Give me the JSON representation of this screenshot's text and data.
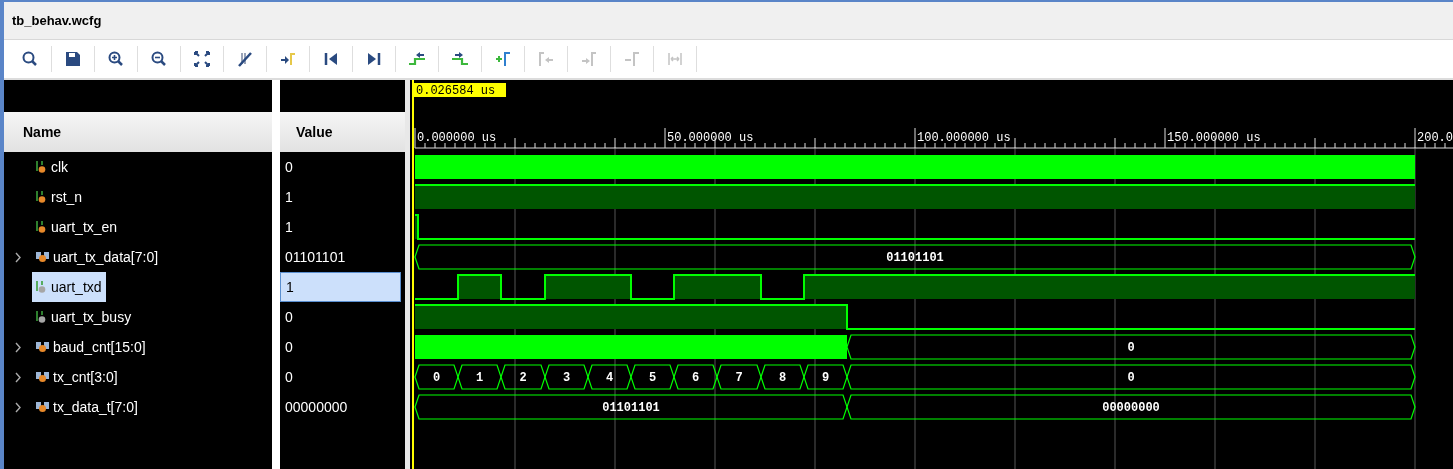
{
  "window": {
    "title": "tb_behav.wcfg"
  },
  "toolbar": [
    {
      "kind": "search",
      "disabled": false
    },
    {
      "kind": "save",
      "disabled": false
    },
    {
      "kind": "zoom-in",
      "disabled": false
    },
    {
      "kind": "zoom-out",
      "disabled": false
    },
    {
      "kind": "fit",
      "disabled": false
    },
    {
      "kind": "cursor-off",
      "disabled": false
    },
    {
      "kind": "to-cursor",
      "disabled": false
    },
    {
      "kind": "first",
      "disabled": false
    },
    {
      "kind": "last",
      "disabled": false
    },
    {
      "kind": "prev-edge",
      "disabled": false
    },
    {
      "kind": "next-edge",
      "disabled": false
    },
    {
      "kind": "add-marker",
      "disabled": false
    },
    {
      "kind": "prev-marker",
      "disabled": true
    },
    {
      "kind": "next-marker",
      "disabled": true
    },
    {
      "kind": "remove-marker",
      "disabled": true
    },
    {
      "kind": "span",
      "disabled": true
    }
  ],
  "cursor": {
    "label": "0.026584 us"
  },
  "timeline": {
    "labels": [
      "0.000000 us",
      "50.000000 us",
      "100.000000 us",
      "150.000000 us",
      "200.0"
    ]
  },
  "columns": [
    "Name",
    "Value"
  ],
  "signals": [
    {
      "name": "clk",
      "value": "0",
      "kind": "bit",
      "color": "#e8892a",
      "selected": false
    },
    {
      "name": "rst_n",
      "value": "1",
      "kind": "bit",
      "color": "#e8892a",
      "selected": false
    },
    {
      "name": "uart_tx_en",
      "value": "1",
      "kind": "bit",
      "color": "#e8892a",
      "selected": false
    },
    {
      "name": "uart_tx_data[7:0]",
      "value": "01101101",
      "kind": "bus",
      "color": "#e8892a",
      "expanded": false,
      "selected": false,
      "segments": [
        "01101101"
      ]
    },
    {
      "name": "uart_txd",
      "value": "1",
      "kind": "bit",
      "color": "#a6a6a6",
      "selected": true
    },
    {
      "name": "uart_tx_busy",
      "value": "0",
      "kind": "bit",
      "color": "#a6a6a6",
      "selected": false
    },
    {
      "name": "baud_cnt[15:0]",
      "value": "0",
      "kind": "bus",
      "color": "#e8892a",
      "expanded": false,
      "selected": false,
      "segments": [
        "0"
      ]
    },
    {
      "name": "tx_cnt[3:0]",
      "value": "0",
      "kind": "bus",
      "color": "#e8892a",
      "expanded": false,
      "selected": false,
      "segments": [
        "0",
        "1",
        "2",
        "3",
        "4",
        "5",
        "6",
        "7",
        "8",
        "9",
        "0"
      ]
    },
    {
      "name": "tx_data_t[7:0]",
      "value": "00000000",
      "kind": "bus",
      "color": "#e8892a",
      "expanded": false,
      "selected": false,
      "segments": [
        "01101101",
        "00000000"
      ]
    }
  ]
}
